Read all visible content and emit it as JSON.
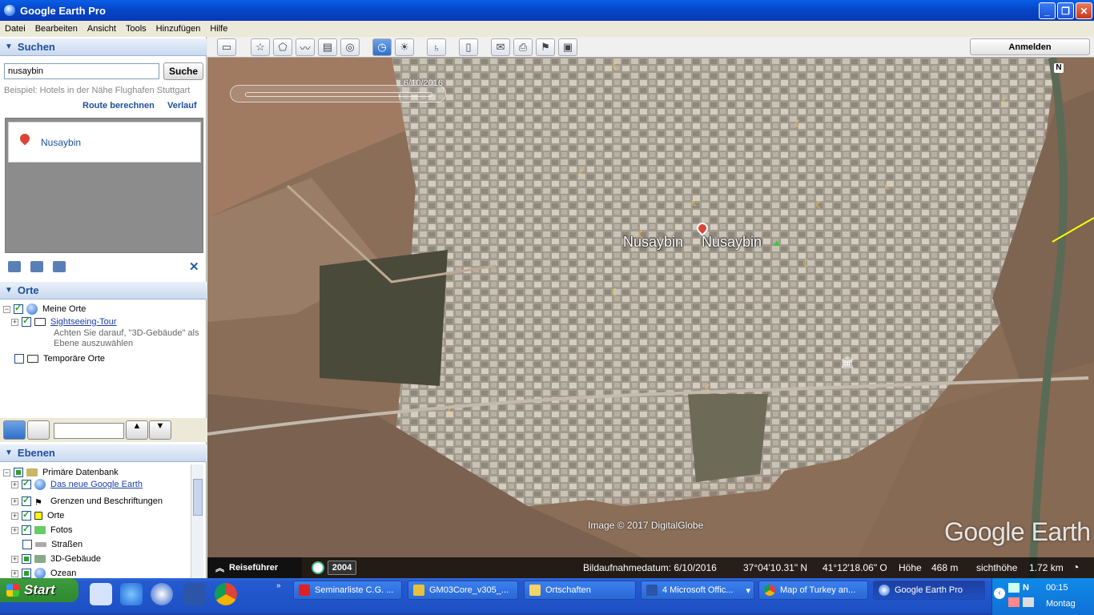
{
  "window": {
    "title": "Google Earth Pro"
  },
  "menu": [
    "Datei",
    "Bearbeiten",
    "Ansicht",
    "Tools",
    "Hinzufügen",
    "Hilfe"
  ],
  "search": {
    "header": "Suchen",
    "query": "nusaybin",
    "button": "Suche",
    "example": "Beispiel: Hotels in der Nähe Flughafen Stuttgart",
    "route": "Route berechnen",
    "history": "Verlauf",
    "result": "Nusaybin"
  },
  "places": {
    "header": "Orte",
    "my_places": "Meine Orte",
    "tour": "Sightseeing-Tour",
    "tour_note1": "Achten Sie darauf, \"3D-Gebäude\" als",
    "tour_note2": "Ebene auszuwählen",
    "temp": "Temporäre Orte"
  },
  "layers": {
    "header": "Ebenen",
    "items": [
      "Primäre Datenbank",
      "Das neue Google Earth",
      "Grenzen und Beschriftungen",
      "Orte",
      "Fotos",
      "Straßen",
      "3D-Gebäude",
      "Ozean"
    ]
  },
  "toolbar": {
    "login": "Anmelden"
  },
  "map": {
    "time_date": "6/10/2016",
    "labels": [
      "Nusaybin",
      "Nusaybin"
    ],
    "copyright": "Image © 2017 DigitalGlobe",
    "logo": "Google Earth",
    "north": "N"
  },
  "status": {
    "guide": "Reiseführer",
    "year": "2004",
    "date": "Bildaufnahmedatum: 6/10/2016",
    "lat": "37°04'10.31\" N",
    "lon": "41°12'18.06\" O",
    "elev_label": "Höhe",
    "elev": "468 m",
    "eye_label": "sichthöhe",
    "eye": "1.72 km"
  },
  "taskbar": {
    "start": "Start",
    "tasks": [
      "Seminarliste C.G. ...",
      "GM03Core_v305_...",
      "Ortschaften",
      "4 Microsoft Offic...",
      "Map of Turkey an...",
      "Google Earth Pro"
    ],
    "time": "00:15",
    "day": "Montag"
  }
}
